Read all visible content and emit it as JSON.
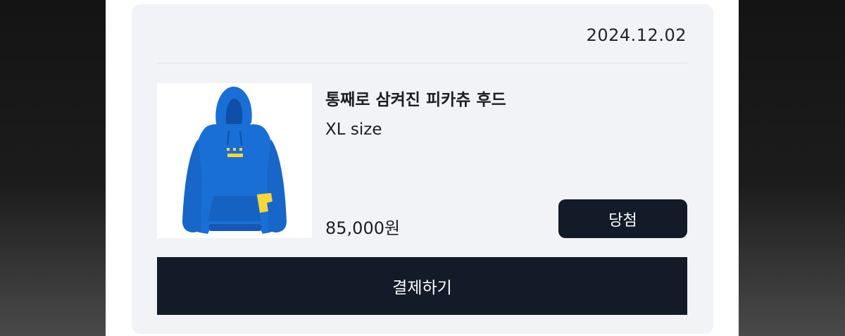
{
  "order": {
    "date": "2024.12.02",
    "product": {
      "title": "통째로 삼켜진 피카츄 후드",
      "option": "XL size",
      "price": "85,000원",
      "image_icon": "hoodie-image"
    },
    "status_label": "당첨",
    "pay_label": "결제하기"
  },
  "colors": {
    "card_background": "#f2f3f6",
    "button_background": "#131a28",
    "hoodie_blue": "#1a6fd6",
    "pikachu_yellow": "#f5d63d"
  }
}
